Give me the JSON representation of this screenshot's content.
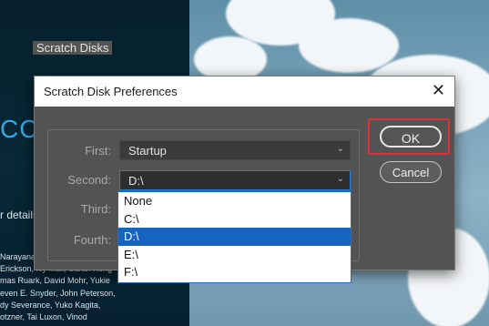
{
  "background": {
    "app_name_fragment": "CC",
    "details_fragment": "r details",
    "credits_lines": [
      "Narayana",
      "Erickson, Ivy Mak, Sarah Kong",
      "mas Ruark, David Mohr, Yukie",
      "even E. Snyder, John Peterson,",
      "dy Severance, Yuko Kagita,",
      "otzner, Tai Luxon, Vinod"
    ]
  },
  "dialog": {
    "title": "Scratch Disk Preferences",
    "close_label": "✕",
    "group_label": "Scratch Disks",
    "rows": [
      {
        "label": "First:",
        "value": "Startup"
      },
      {
        "label": "Second:",
        "value": "D:\\"
      },
      {
        "label": "Third:",
        "value": ""
      },
      {
        "label": "Fourth:",
        "value": ""
      }
    ],
    "dropdown_options": [
      "None",
      "C:\\",
      "D:\\",
      "E:\\",
      "F:\\"
    ],
    "dropdown_selected": "D:\\",
    "ok_label": "OK",
    "cancel_label": "Cancel"
  },
  "colors": {
    "highlight": "#e0323a",
    "selection": "#1464c0",
    "dialog_bg": "#535353"
  }
}
